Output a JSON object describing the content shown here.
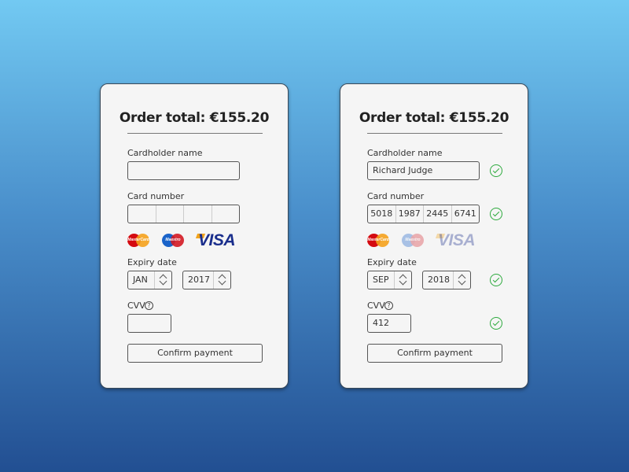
{
  "colors": {
    "background_top": "#72c9f2",
    "background_bottom": "#224f92",
    "card_bg": "#f5f5f5",
    "valid_check": "#2eaa3e",
    "visa_blue": "#1a2e8c"
  },
  "forms": [
    {
      "state": "empty",
      "title": "Order total: €155.20",
      "cardholder_label": "Cardholder name",
      "cardholder_value": "",
      "card_number_label": "Card number",
      "card_number_segments": [
        "",
        "",
        "",
        ""
      ],
      "card_brands": [
        {
          "name": "MasterCard",
          "text": "MasterCard",
          "active": true
        },
        {
          "name": "Maestro",
          "text": "Maestro",
          "active": true
        },
        {
          "name": "Visa",
          "text": "VISA",
          "active": true
        }
      ],
      "expiry_label": "Expiry date",
      "expiry_month": "JAN",
      "expiry_year": "2017",
      "cvv_label": "CVV",
      "cvv_help_icon": "?",
      "cvv_value": "",
      "confirm_label": "Confirm payment",
      "validation": {
        "cardholder": false,
        "card_number": false,
        "expiry": false,
        "cvv": false
      }
    },
    {
      "state": "filled",
      "title": "Order total: €155.20",
      "cardholder_label": "Cardholder name",
      "cardholder_value": "Richard Judge",
      "card_number_label": "Card number",
      "card_number_segments": [
        "5018",
        "1987",
        "2445",
        "6741"
      ],
      "card_brands": [
        {
          "name": "MasterCard",
          "text": "MasterCard",
          "active": true
        },
        {
          "name": "Maestro",
          "text": "Maestro",
          "active": false
        },
        {
          "name": "Visa",
          "text": "VISA",
          "active": false
        }
      ],
      "expiry_label": "Expiry date",
      "expiry_month": "SEP",
      "expiry_year": "2018",
      "cvv_label": "CVV",
      "cvv_help_icon": "?",
      "cvv_value": "412",
      "confirm_label": "Confirm payment",
      "validation": {
        "cardholder": true,
        "card_number": true,
        "expiry": true,
        "cvv": true
      }
    }
  ]
}
